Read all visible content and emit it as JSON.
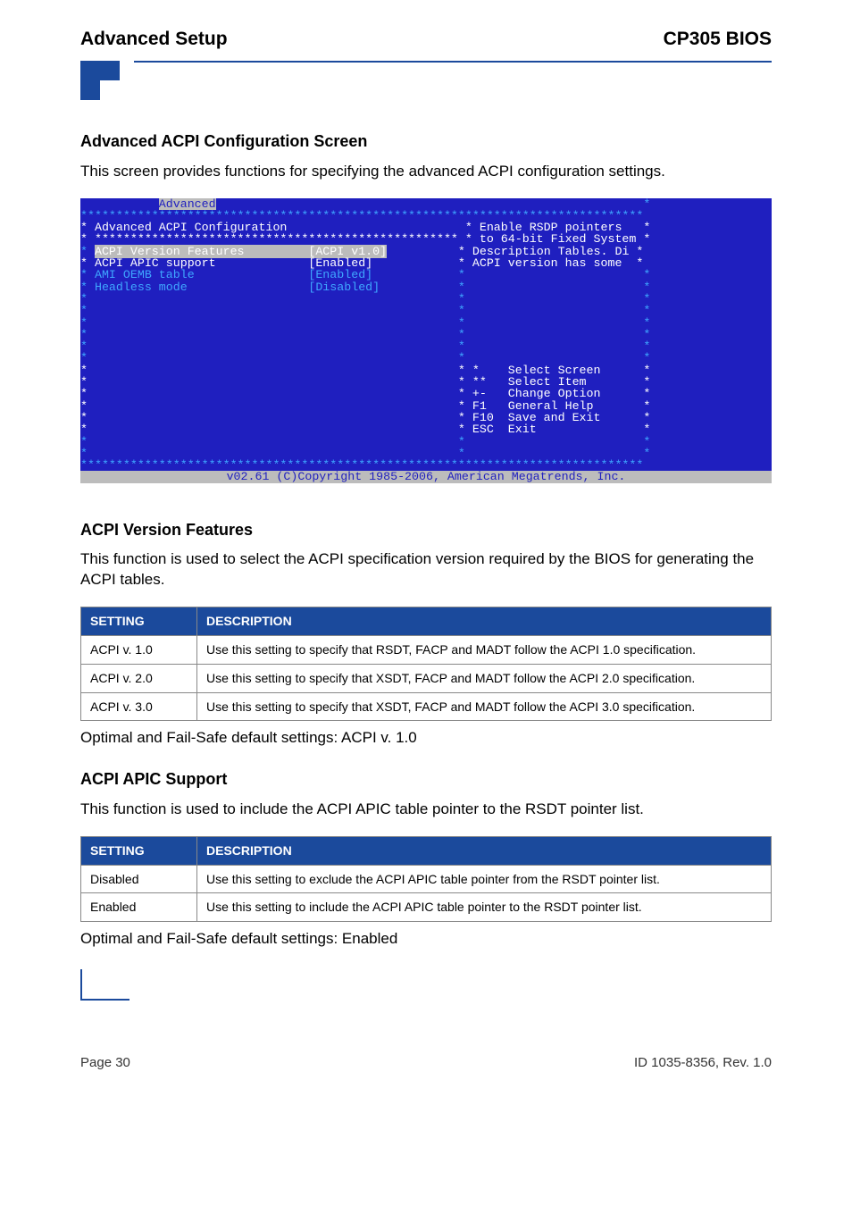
{
  "header": {
    "left": "Advanced Setup",
    "right": "CP305 BIOS"
  },
  "section1": {
    "title": "Advanced ACPI Configuration Screen",
    "desc": "This screen provides functions for specifying the advanced ACPI configuration settings."
  },
  "bios": {
    "tab": "Advanced",
    "border_top": "*******************************************************************************",
    "title_line": "* Advanced ACPI Configuration                         * Enable RSDP pointers   *",
    "sep_line": "* *************************************************** * to 64-bit Fixed System *",
    "row1_left": "* ",
    "row1_item": "ACPI Version Features         [ACPI v1.0]",
    "row1_right": "          * Description Tables. Di *",
    "row2": "* ACPI APIC support             [Enabled]            * ACPI version has some  *",
    "row3": "* AMI OEMB table                [Enabled]            *                         *",
    "row4": "* Headless mode                 [Disabled]           *                         *",
    "blank": "*                                                    *                         *",
    "nav1": "*                                                    * *    Select Screen      *",
    "nav2": "*                                                    * **   Select Item        *",
    "nav3": "*                                                    * +-   Change Option      *",
    "nav4": "*                                                    * F1   General Help       *",
    "nav5": "*                                                    * F10  Save and Exit      *",
    "nav6": "*                                                    * ESC  Exit               *",
    "footer": "v02.61 (C)Copyright 1985-2006, American Megatrends, Inc."
  },
  "section2": {
    "title": "ACPI Version Features",
    "desc": "This function is used to select the ACPI specification version required by the BIOS for generating the ACPI tables.",
    "th1": "Setting",
    "th2": "Description",
    "rows": [
      {
        "s": "ACPI v. 1.0",
        "d": "Use this setting to specify that RSDT, FACP and MADT follow the ACPI 1.0 specification."
      },
      {
        "s": "ACPI v. 2.0",
        "d": "Use this setting to specify that XSDT, FACP and MADT follow the ACPI 2.0 specification."
      },
      {
        "s": "ACPI v. 3.0",
        "d": "Use this setting to specify that XSDT, FACP and MADT follow the ACPI 3.0 specification."
      }
    ],
    "default": "Optimal and Fail-Safe default settings: ACPI v. 1.0"
  },
  "section3": {
    "title": "ACPI APIC Support",
    "desc": "This function is used to include the ACPI APIC table pointer to the RSDT pointer list.",
    "th1": "Setting",
    "th2": "Description",
    "rows": [
      {
        "s": "Disabled",
        "d": "Use this setting to exclude the ACPI APIC table pointer from the RSDT pointer list."
      },
      {
        "s": "Enabled",
        "d": "Use this setting to include the ACPI APIC table pointer to the RSDT pointer list."
      }
    ],
    "default": "Optimal and Fail-Safe default settings: Enabled"
  },
  "footer": {
    "left": "Page 30",
    "right": "ID 1035-8356, Rev. 1.0"
  }
}
